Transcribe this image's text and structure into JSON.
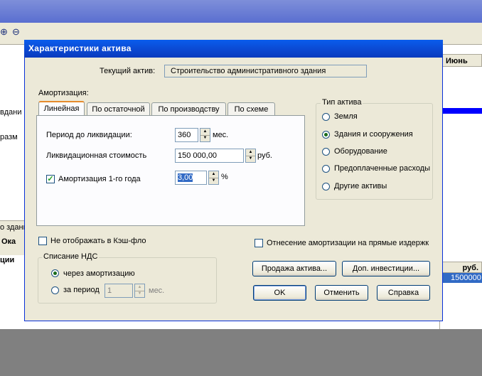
{
  "background": {
    "header_month": "Июнь",
    "header_currency": "руб.",
    "selected_value": "1500000",
    "left_text_1": "вдани",
    "left_text_2": "разм",
    "left_text_3": "о здани",
    "left_text_4": "Ока",
    "left_text_5": "ции"
  },
  "dialog": {
    "title": "Характеристики актива",
    "current_asset_label": "Текущий актив:",
    "current_asset_value": "Строительство административного здания",
    "amortization_label": "Амортизация:",
    "tabs": [
      {
        "label": "Линейная"
      },
      {
        "label": "По остаточной"
      },
      {
        "label": "По производству"
      },
      {
        "label": "По схеме"
      }
    ],
    "period_label": "Период до ликвидации:",
    "period_value": "360",
    "period_unit": "мес.",
    "liquidation_label": "Ликвидационная стоимость",
    "liquidation_value": "150 000,00",
    "liquidation_unit": "руб.",
    "first_year_label": "Амортизация 1-го года",
    "first_year_value": "3,00",
    "first_year_unit": "%",
    "asset_type_label": "Тип актива",
    "asset_types": [
      {
        "label": "Земля"
      },
      {
        "label": "Здания и сооружения"
      },
      {
        "label": "Оборудование"
      },
      {
        "label": "Предоплаченные расходы"
      },
      {
        "label": "Другие активы"
      }
    ],
    "hide_cashflow_label": "Не отображать в Кэш-фло",
    "direct_costs_label": "Отнесение амортизации на прямые издержк",
    "vat_label": "Списание НДС",
    "vat_option_1": "через амортизацию",
    "vat_option_2": "за период",
    "vat_period_value": "1",
    "vat_period_unit": "мес.",
    "sell_button": "Продажа актива...",
    "invest_button": "Доп. инвестиции...",
    "ok_button": "OK",
    "cancel_button": "Отменить",
    "help_button": "Справка"
  }
}
